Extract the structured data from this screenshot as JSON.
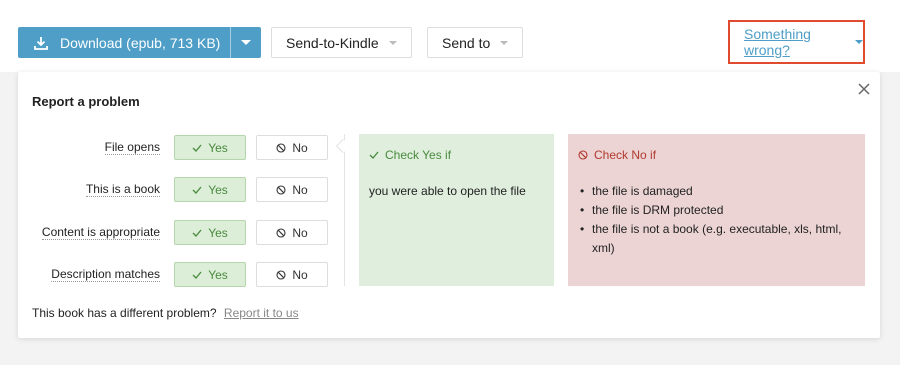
{
  "toolbar": {
    "download_label": "Download (epub, 713 KB)",
    "send_to_kindle_label": "Send-to-Kindle",
    "send_to_label": "Send to",
    "something_wrong_label": "Something wrong?"
  },
  "panel": {
    "title": "Report a problem",
    "rows": [
      {
        "label": "File opens",
        "yes": "Yes",
        "no": "No",
        "selected": "yes"
      },
      {
        "label": "This is a book",
        "yes": "Yes",
        "no": "No",
        "selected": "yes"
      },
      {
        "label": "Content is appropriate",
        "yes": "Yes",
        "no": "No",
        "selected": "yes"
      },
      {
        "label": "Description matches",
        "yes": "Yes",
        "no": "No",
        "selected": "yes"
      }
    ],
    "yes_card": {
      "title": "Check Yes if",
      "text": "you were able to open the file"
    },
    "no_card": {
      "title": "Check No if",
      "items": [
        "the file is damaged",
        "the file is DRM protected",
        "the file is not a book (e.g. executable, xls, html, xml)"
      ]
    },
    "footer_text": "This book has a different problem?",
    "footer_link": "Report it to us"
  },
  "colors": {
    "primary": "#4e9ec7",
    "yes_bg": "#dcedd8",
    "yes_text": "#4a8a3e",
    "no_card_bg": "#ecd4d4",
    "no_text": "#b0392f",
    "highlight_border": "#e04a2f"
  },
  "icons": [
    "download-icon",
    "chevron-down-icon",
    "close-icon",
    "check-icon",
    "no-entry-icon"
  ]
}
